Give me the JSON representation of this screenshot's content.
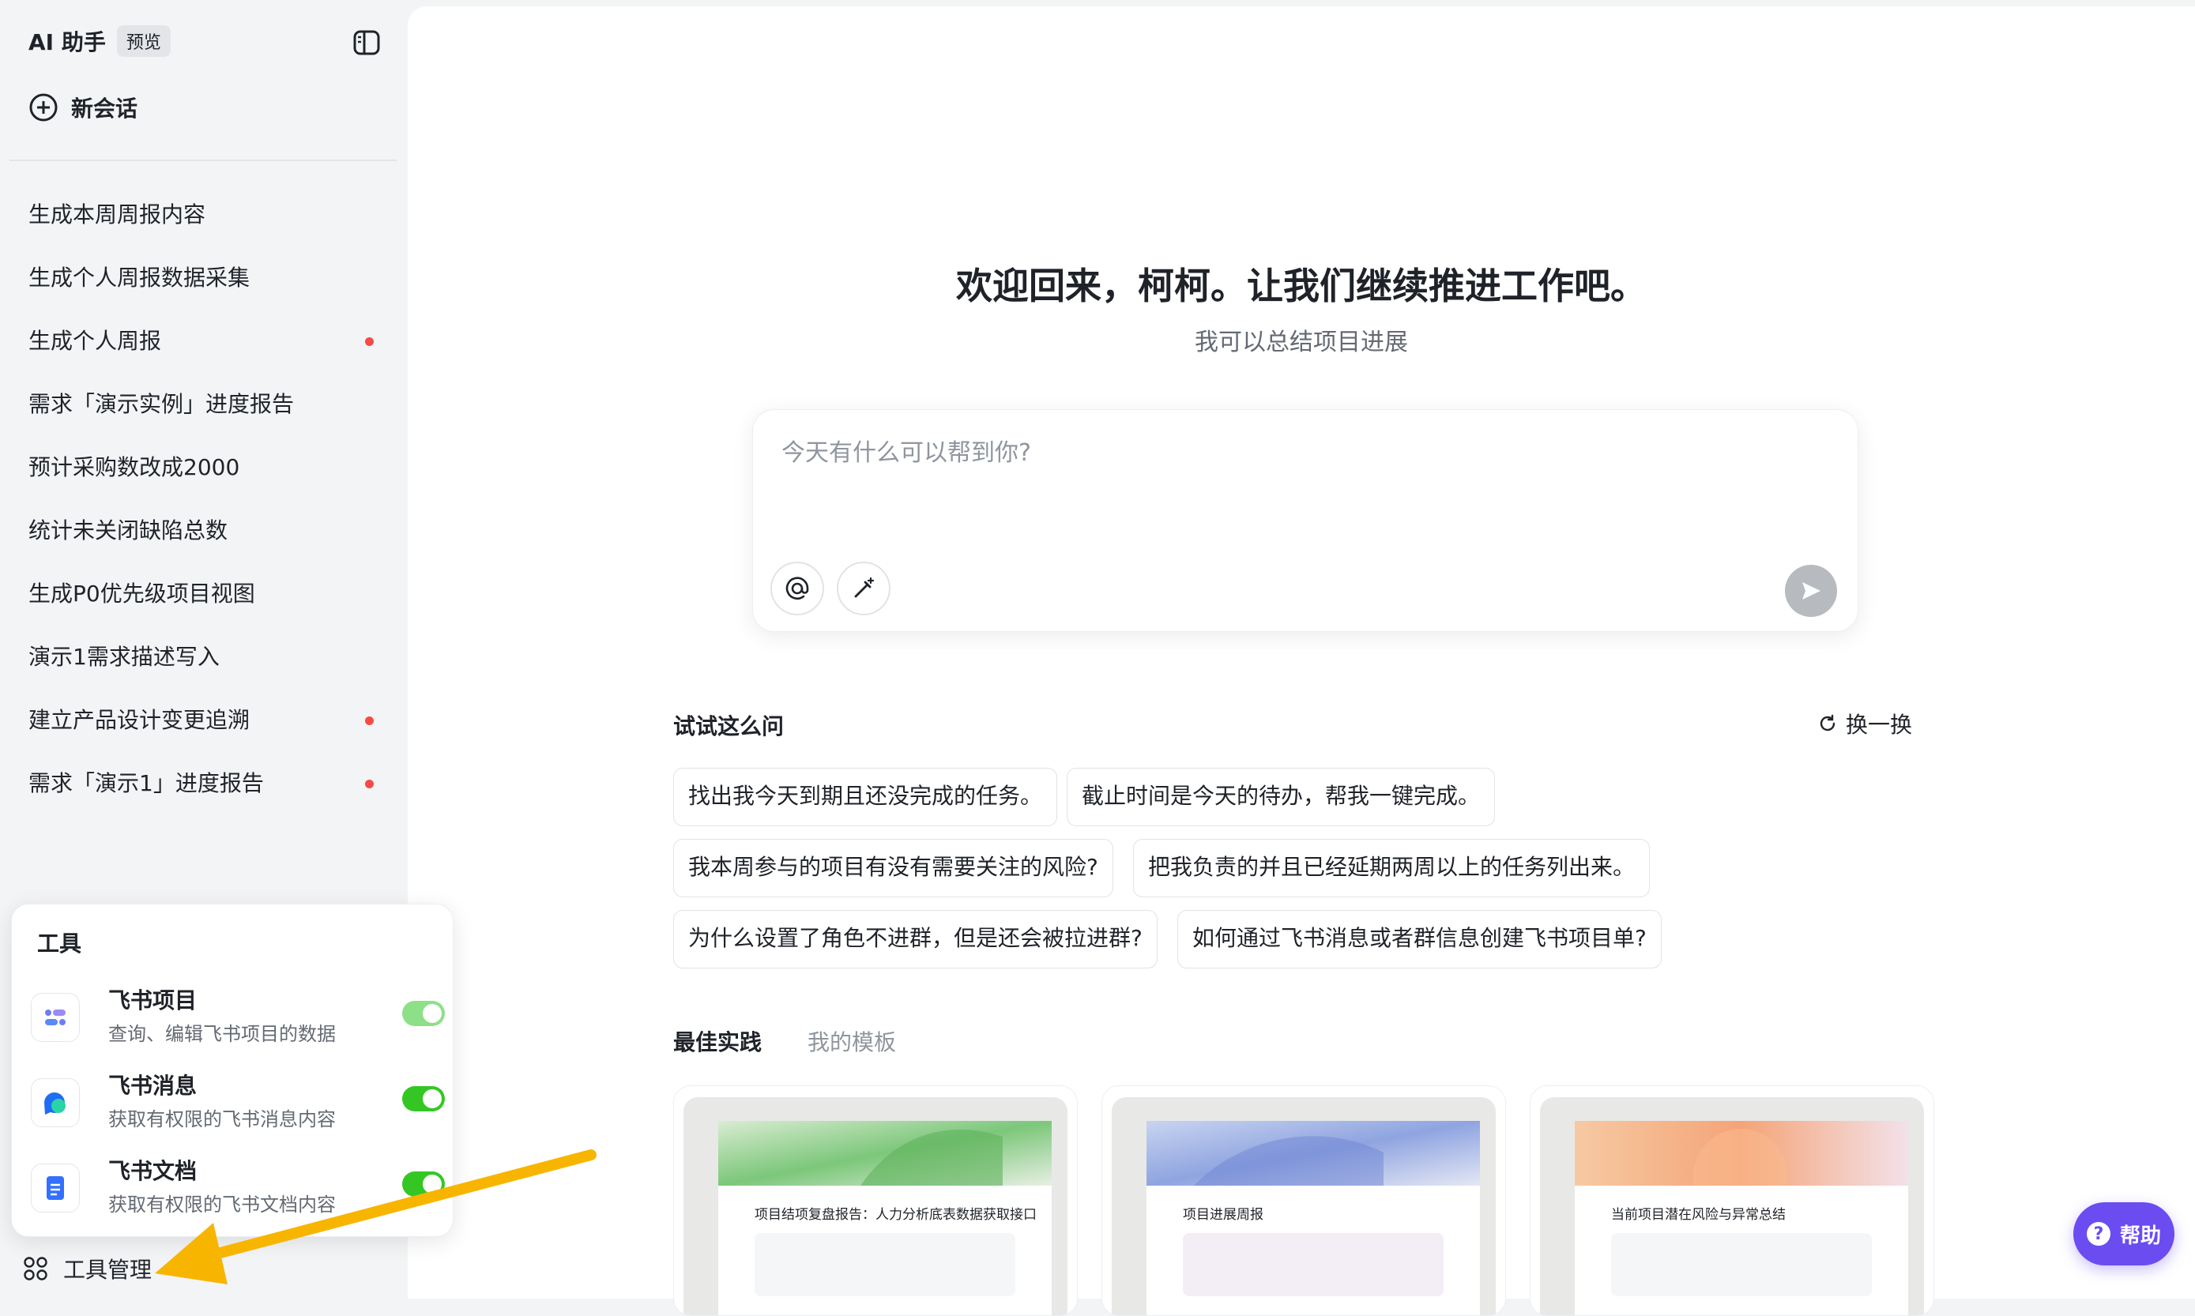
{
  "app": {
    "title": "AI 助手",
    "badge": "预览"
  },
  "sidebar": {
    "new_chat_label": "新会话",
    "history": [
      {
        "label": "生成本周周报内容",
        "unread": false
      },
      {
        "label": "生成个人周报数据采集",
        "unread": false
      },
      {
        "label": "生成个人周报",
        "unread": true
      },
      {
        "label": "需求「演示实例」进度报告",
        "unread": false
      },
      {
        "label": "预计采购数改成2000",
        "unread": false
      },
      {
        "label": "统计未关闭缺陷总数",
        "unread": false
      },
      {
        "label": "生成P0优先级项目视图",
        "unread": false
      },
      {
        "label": "演示1需求描述写入",
        "unread": false
      },
      {
        "label": "建立产品设计变更追溯",
        "unread": true
      },
      {
        "label": "需求「演示1」进度报告",
        "unread": true
      }
    ],
    "tool_manage_label": "工具管理"
  },
  "tools_panel": {
    "title": "工具",
    "items": [
      {
        "name": "飞书项目",
        "desc": "查询、编辑飞书项目的数据",
        "enabled": true,
        "icon": "feishu-project-icon"
      },
      {
        "name": "飞书消息",
        "desc": "获取有权限的飞书消息内容",
        "enabled": true,
        "icon": "feishu-message-icon"
      },
      {
        "name": "飞书文档",
        "desc": "获取有权限的飞书文档内容",
        "enabled": true,
        "icon": "feishu-doc-icon"
      }
    ]
  },
  "main": {
    "welcome": "欢迎回来，柯柯。让我们继续推进工作吧。",
    "subtitle": "我可以总结项目进展",
    "input_placeholder": "今天有什么可以帮到你?",
    "try_label": "试试这么问",
    "refresh_label": "换一换",
    "suggestions": [
      "找出我今天到期且还没完成的任务。",
      "截止时间是今天的待办，帮我一键完成。",
      "我本周参与的项目有没有需要关注的风险?",
      "把我负责的并且已经延期两周以上的任务列出来。",
      "为什么设置了角色不进群，但是还会被拉进群?",
      "如何通过飞书消息或者群信息创建飞书项目单?"
    ],
    "tabs": [
      {
        "label": "最佳实践",
        "active": true
      },
      {
        "label": "我的模板",
        "active": false
      }
    ],
    "cards": [
      {
        "title": "项目结项复盘报告：人力分析底表数据获取接口"
      },
      {
        "title": "项目进展周报"
      },
      {
        "title": "当前项目潜在风险与异常总结"
      }
    ]
  },
  "help_label": "帮助",
  "colors": {
    "accent": "#6a4cf0",
    "toggle_on": "#34c724",
    "unread_dot": "#f54a45"
  }
}
